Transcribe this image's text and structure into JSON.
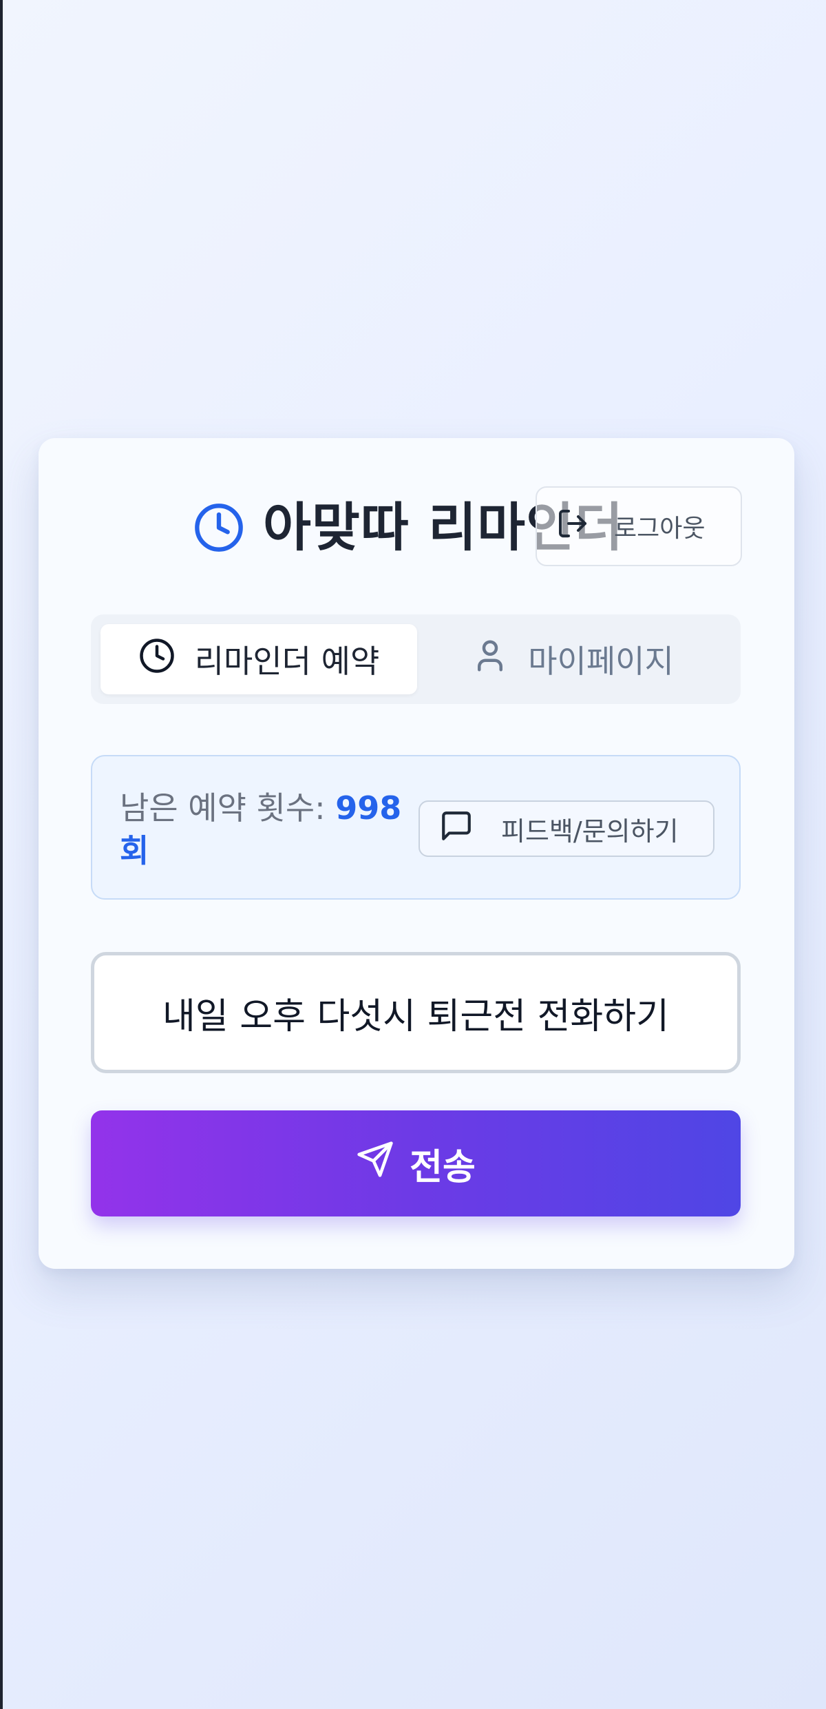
{
  "header": {
    "title": "아맞따 리마인더",
    "logout_label": "로그아웃"
  },
  "tabs": [
    {
      "label": "리마인더 예약",
      "active": true
    },
    {
      "label": "마이페이지",
      "active": false
    }
  ],
  "quota": {
    "label": "남은 예약 횟수:",
    "count": "998",
    "unit": "회",
    "feedback_label": "피드백/문의하기"
  },
  "message": {
    "value": "내일 오후 다섯시 퇴근전 전화하기"
  },
  "send": {
    "label": "전송"
  },
  "colors": {
    "accent": "#2563eb",
    "button_gradient_start": "#9333ea",
    "button_gradient_end": "#4f46e5",
    "title_text": "#1e2533"
  },
  "icons": [
    "clock-icon",
    "logout-icon",
    "user-icon",
    "message-square-icon",
    "send-icon"
  ]
}
